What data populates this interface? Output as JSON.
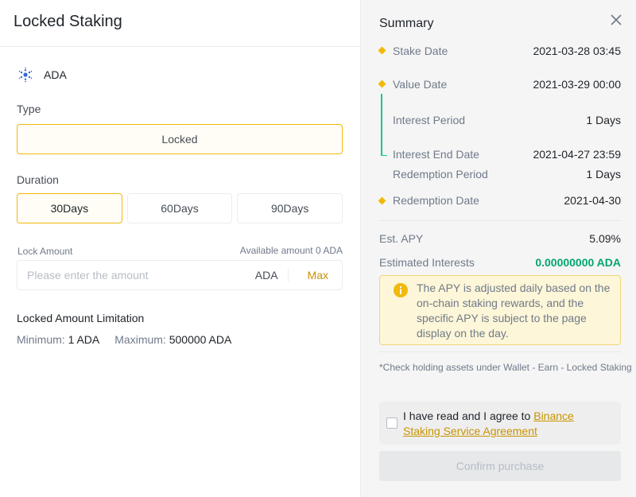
{
  "header": {
    "title": "Locked Staking"
  },
  "coin": {
    "name": "ADA",
    "icon": "cardano-icon"
  },
  "type": {
    "label": "Type",
    "value": "Locked"
  },
  "duration": {
    "label": "Duration",
    "options": [
      "30Days",
      "60Days",
      "90Days"
    ],
    "selected": "30Days"
  },
  "lock_amount": {
    "label": "Lock Amount",
    "available": "Available amount 0 ADA",
    "placeholder": "Please enter the amount",
    "unit": "ADA",
    "max_label": "Max"
  },
  "limitation": {
    "title": "Locked Amount Limitation",
    "min_label": "Minimum:",
    "min_value": "1 ADA",
    "max_label": "Maximum:",
    "max_value": "500000 ADA"
  },
  "summary": {
    "title": "Summary",
    "stake_date_label": "Stake Date",
    "stake_date": "2021-03-28 03:45",
    "value_date_label": "Value Date",
    "value_date": "2021-03-29 00:00",
    "interest_period_label": "Interest Period",
    "interest_period": "1 Days",
    "interest_end_label": "Interest End Date",
    "interest_end": "2021-04-27 23:59",
    "redemption_period_label": "Redemption Period",
    "redemption_period": "1 Days",
    "redemption_date_label": "Redemption Date",
    "redemption_date": "2021-04-30",
    "apy_label": "Est. APY",
    "apy": "5.09%",
    "interests_label": "Estimated Interests",
    "interests": "0.00000000 ADA",
    "notice": "The APY is adjusted daily based on the on-chain staking rewards, and the specific APY is subject to the page display on the day.",
    "check_note": "*Check holding assets under Wallet - Earn - Locked Staking",
    "agree_text": "I have read and I agree to ",
    "agree_link": "Binance Staking Service Agreement",
    "confirm_label": "Confirm purchase"
  },
  "colors": {
    "accent": "#f0b90b",
    "green": "#0ecb81",
    "interest": "#03a66d"
  }
}
